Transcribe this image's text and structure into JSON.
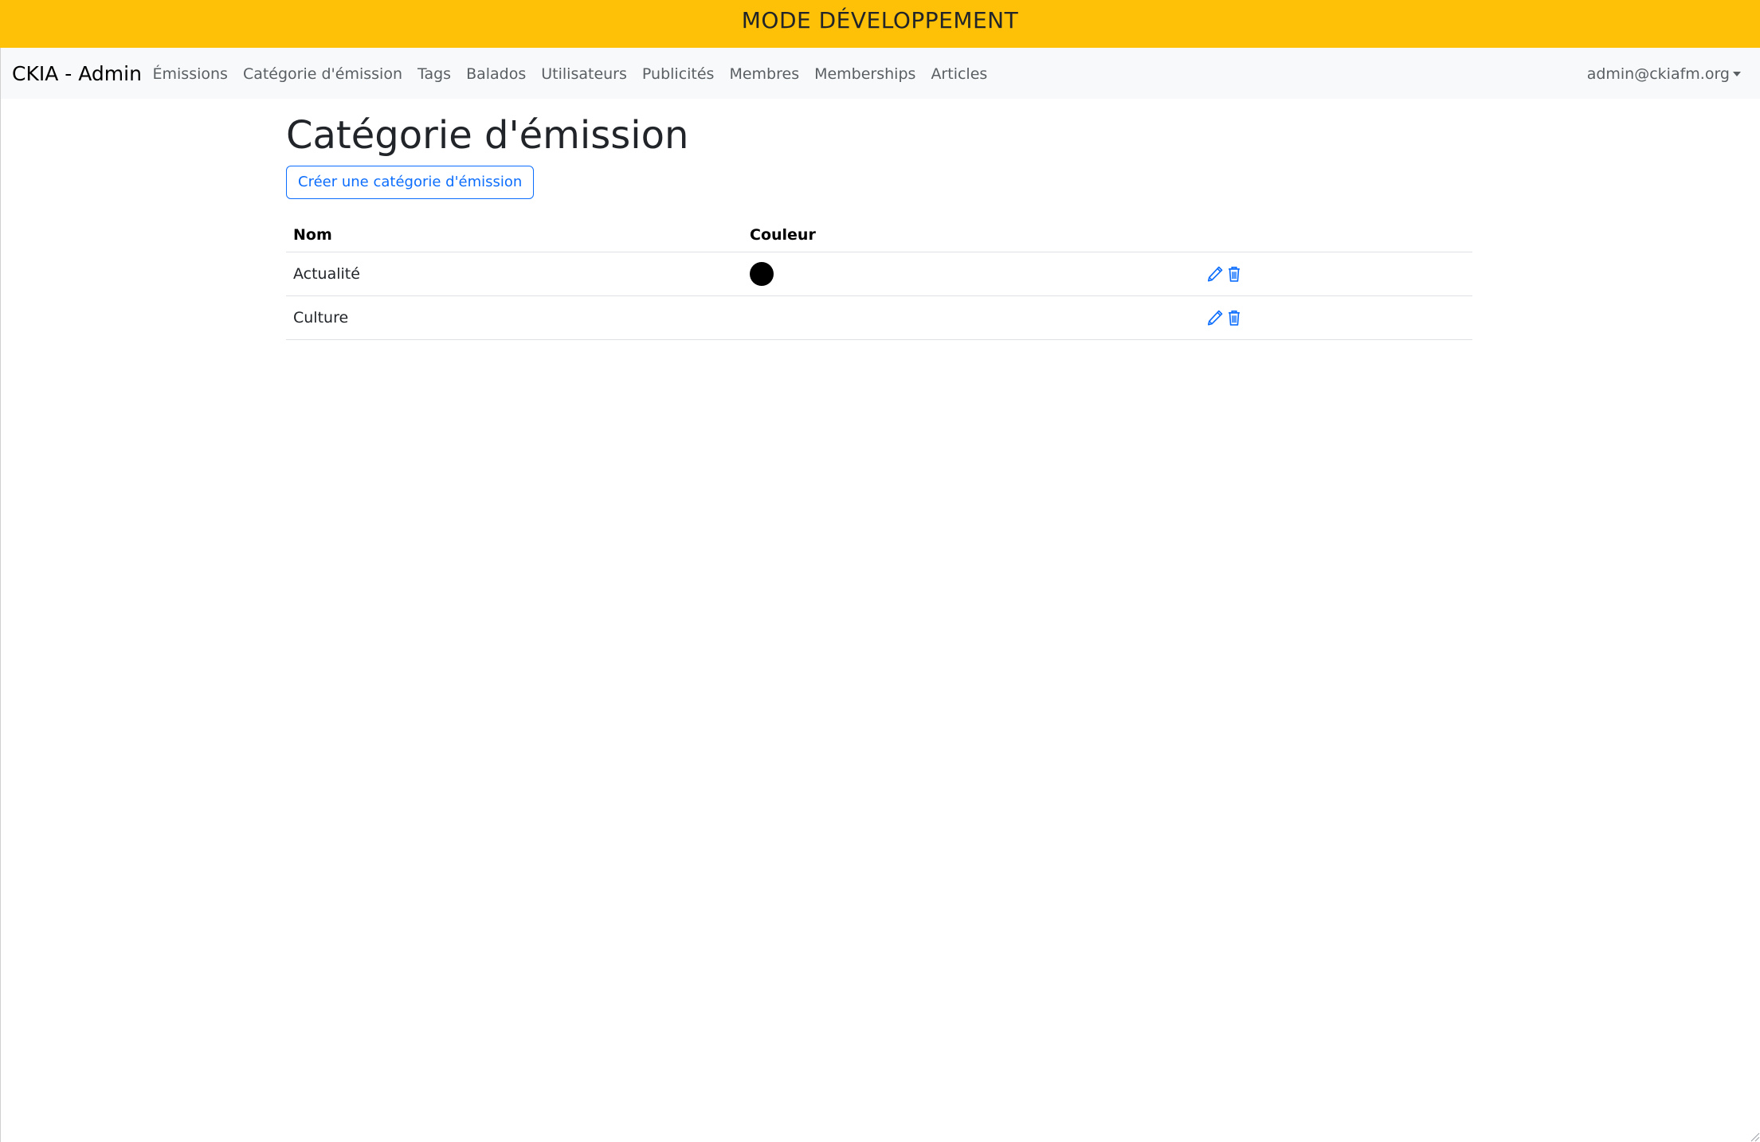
{
  "banner": {
    "text": "MODE DÉVELOPPEMENT",
    "color": "#ffc107"
  },
  "navbar": {
    "brand": "CKIA - Admin",
    "links": [
      "Émissions",
      "Catégorie d'émission",
      "Tags",
      "Balados",
      "Utilisateurs",
      "Publicités",
      "Membres",
      "Memberships",
      "Articles"
    ],
    "user": "admin@ckiafm.org"
  },
  "page": {
    "title": "Catégorie d'émission",
    "create_button": "Créer une catégorie d'émission"
  },
  "table": {
    "headers": {
      "name": "Nom",
      "color": "Couleur",
      "actions": ""
    },
    "rows": [
      {
        "name": "Actualité",
        "color": "#000000",
        "icons": [
          "pencil-icon",
          "trash-icon"
        ]
      },
      {
        "name": "Culture",
        "color": "",
        "icons": [
          "pencil-icon",
          "trash-icon"
        ]
      }
    ]
  },
  "theme": {
    "accent": "#0d6efd",
    "navbar_bg": "#f8f9fa"
  }
}
